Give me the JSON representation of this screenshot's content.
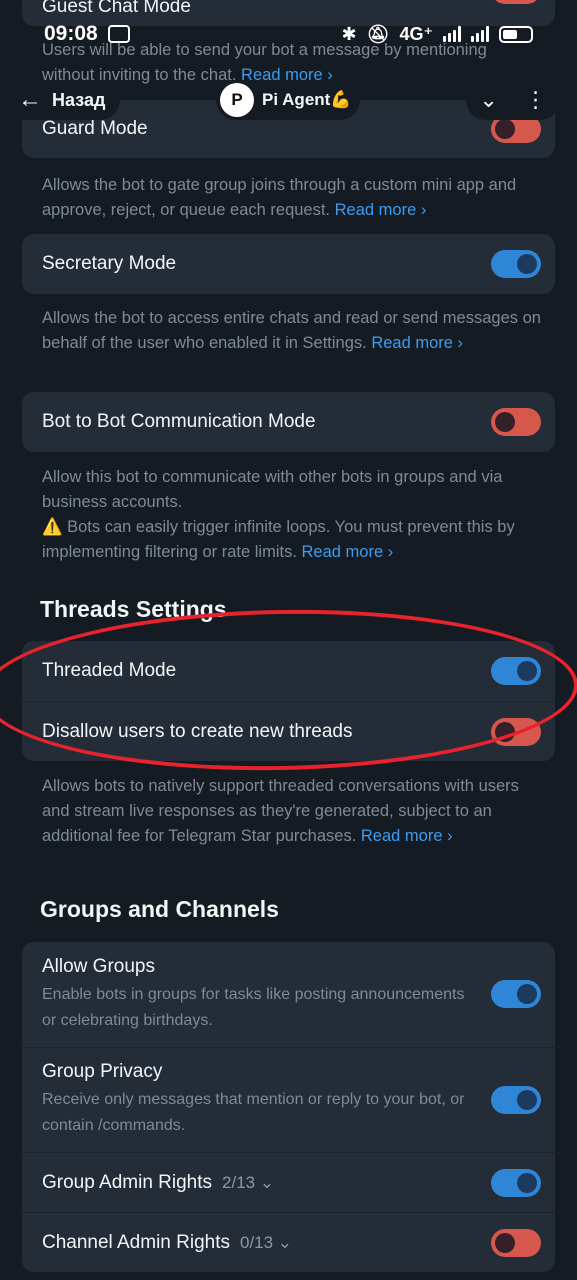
{
  "status_bar": {
    "time": "09:08",
    "network": "4G⁺"
  },
  "nav": {
    "back_label": "Назад",
    "bot_name": "Pi Agent💪",
    "logo_letter": "P"
  },
  "top_row": {
    "label": "Guest Chat Mode"
  },
  "guest_desc": {
    "text": "Users will be able to send your bot a message by mentioning without inviting to the chat.",
    "link": "Read more ›"
  },
  "guard": {
    "label": "Guard Mode",
    "state": "off"
  },
  "guard_desc": {
    "text": "Allows the bot to gate group joins through a custom mini app and approve, reject, or queue each request.",
    "link": "Read more ›"
  },
  "secretary": {
    "label": "Secretary Mode",
    "state": "on"
  },
  "secretary_desc": {
    "text": "Allows the bot to access entire chats and read or send messages on behalf of the user who enabled it in Settings.",
    "link": "Read more ›"
  },
  "b2b": {
    "label": "Bot to Bot Communication Mode",
    "state": "off"
  },
  "b2b_desc": {
    "text": "Allow this bot to communicate with other bots in groups and via business accounts.",
    "warning": "⚠️ Bots can easily trigger infinite loops. You must prevent this by implementing filtering or rate limits.",
    "link": "Read more ›"
  },
  "threads": {
    "title": "Threads Settings",
    "rows": [
      {
        "label": "Threaded Mode",
        "state": "on"
      },
      {
        "label": "Disallow users to create new threads",
        "state": "off"
      }
    ],
    "desc": "Allows bots to natively support threaded conversations with users and stream live responses as they're generated, subject to an additional fee for Telegram Star purchases.",
    "link": "Read more ›"
  },
  "groups": {
    "title": "Groups and Channels",
    "rows": [
      {
        "label": "Allow Groups",
        "sub": "Enable bots in groups for tasks like posting announcements or celebrating birthdays.",
        "state": "on"
      },
      {
        "label": "Group Privacy",
        "sub": "Receive only messages that mention or reply to your bot, or contain /commands.",
        "state": "on"
      },
      {
        "label": "Group Admin Rights",
        "count": "2/13 ⌄",
        "state": "on"
      },
      {
        "label": "Channel Admin Rights",
        "count": "0/13 ⌄",
        "state": "off"
      }
    ]
  },
  "colors": {
    "accent": "#2f86d6",
    "off_toggle": "#d6574c",
    "link": "#3d9cf0",
    "annotation": "#e8232e"
  }
}
